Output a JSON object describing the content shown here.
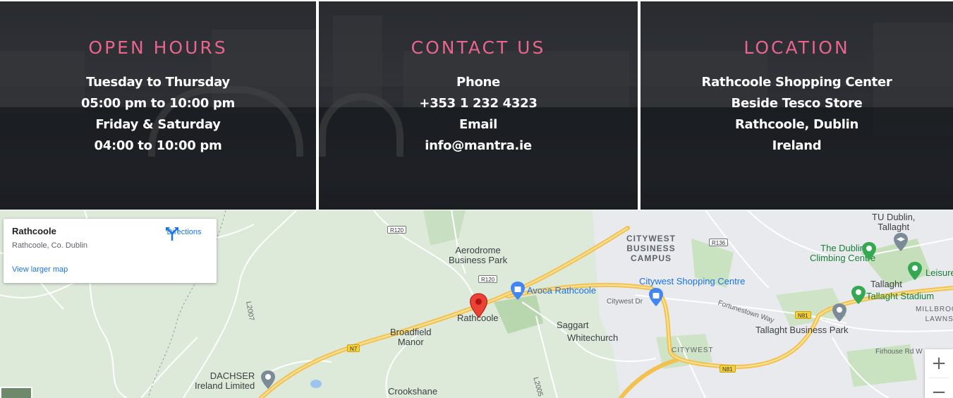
{
  "panels": {
    "hours": {
      "title": "OPEN HOURS",
      "lines": [
        "Tuesday to Thursday",
        "05:00 pm to 10:00 pm",
        "Friday & Saturday",
        "04:00 to 10:00 pm"
      ]
    },
    "contact": {
      "title": "CONTACT US",
      "lines": [
        "Phone",
        "+353 1 232 4323",
        "Email",
        "info@mantra.ie"
      ]
    },
    "location": {
      "title": "LOCATION",
      "lines": [
        "Rathcoole Shopping Center",
        "Beside Tesco Store",
        "Rathcoole, Dublin",
        "Ireland"
      ]
    }
  },
  "map": {
    "card": {
      "place_name": "Rathcoole",
      "address": "Rathcoole, Co. Dublin",
      "directions_label": "Directions",
      "view_larger_label": "View larger map"
    },
    "zoom_in": "+",
    "zoom_out": "−",
    "labels": {
      "aerodrome": "Aerodrome\nBusiness Park",
      "rathcoole": "Rathcoole",
      "broadfield": "Broadfield\nManor",
      "saggart": "Saggart",
      "whitechurch": "Whitechurch",
      "crookshane": "Crookshane",
      "dachser": "DACHSER\nIreland Limited",
      "avoca": "Avoca Rathcoole",
      "citywest_campus": "CITYWEST\nBUSINESS\nCAMPUS",
      "citywest_shopping": "Citywest Shopping Centre",
      "citywest_dr": "Citywest Dr",
      "fortunestown": "Fortunestown Way",
      "citywest_small": "CITYWEST",
      "dublin_climbing": "The Dublin\nClimbing Centre",
      "tu_dublin": "TU Dublin,\nTallaght",
      "tallaght": "Tallaght",
      "tallaght_stadium": "Tallaght Stadium",
      "leisure": "Leisure",
      "millbrook": "MILLBROOK\nLAWNS",
      "tallaght_bp": "Tallaght Business Park",
      "firhouse": "Firhouse Rd W",
      "l2005": "L2005",
      "l2007": "L2007"
    },
    "shields": {
      "r120a": "R120",
      "r120b": "R120",
      "r136": "R136",
      "n7": "N7",
      "n81a": "N81",
      "n81b": "N81"
    },
    "colors": {
      "pin_red": "#ea4335",
      "motorway": "#f6c94e",
      "accent_pink": "#e8658b",
      "link_blue": "#1a73e8"
    }
  }
}
